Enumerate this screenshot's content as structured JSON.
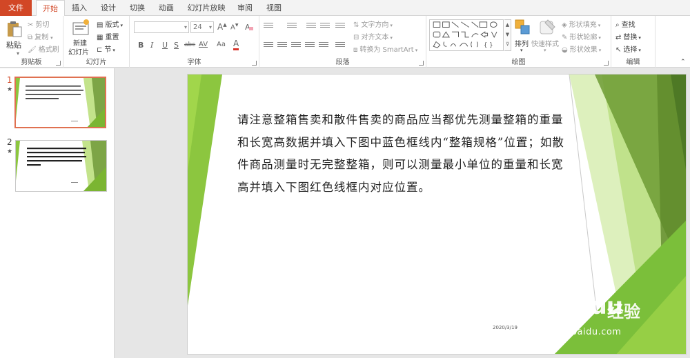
{
  "tabs": {
    "file": "文件",
    "home": "开始",
    "insert": "插入",
    "design": "设计",
    "transitions": "切换",
    "animations": "动画",
    "slideshow": "幻灯片放映",
    "review": "审阅",
    "view": "视图"
  },
  "ribbon": {
    "clipboard": {
      "label": "剪贴板",
      "paste": "粘贴",
      "cut": "剪切",
      "copy": "复制",
      "format_painter": "格式刷"
    },
    "slides": {
      "label": "幻灯片",
      "new_slide_line1": "新建",
      "new_slide_line2": "幻灯片",
      "layout": "版式",
      "reset": "重置",
      "section": "节"
    },
    "font": {
      "label": "字体",
      "font_name": "",
      "font_size": "24",
      "bold": "B",
      "italic": "I",
      "underline": "U",
      "shadow": "S",
      "strike": "abc",
      "spacing": "AV",
      "case": "Aa",
      "color": "A",
      "grow": "A",
      "shrink": "A"
    },
    "paragraph": {
      "label": "段落",
      "text_direction": "文字方向",
      "align_text": "对齐文本",
      "convert_smartart": "转换为 SmartArt"
    },
    "drawing": {
      "label": "绘图",
      "arrange": "排列",
      "quick_styles": "快速样式",
      "shape_fill": "形状填充",
      "shape_outline": "形状轮廓",
      "shape_effects": "形状效果"
    },
    "editing": {
      "label": "编辑",
      "find": "查找",
      "replace": "替换",
      "select": "选择"
    }
  },
  "thumbnails": [
    {
      "number": "1",
      "marker": "★"
    },
    {
      "number": "2",
      "marker": "★"
    }
  ],
  "slide": {
    "body_text": "请注意整箱售卖和散件售卖的商品应当都优先测量整箱的重量和长宽高数据并填入下图中蓝色框线内“整箱规格”位置；如散件商品测量时无完整整箱，则可以测量最小单位的重量和长宽高并填入下图红色线框内对应位置。",
    "date": "2020/3/19"
  },
  "watermark": {
    "logo": "Bai",
    "logo2": "du",
    "cn": "经验",
    "url": "jingyan.baidu.com"
  },
  "colors": {
    "accent": "#d24726",
    "green_light": "#9bd13d",
    "green_dark": "#5f8a2a"
  }
}
